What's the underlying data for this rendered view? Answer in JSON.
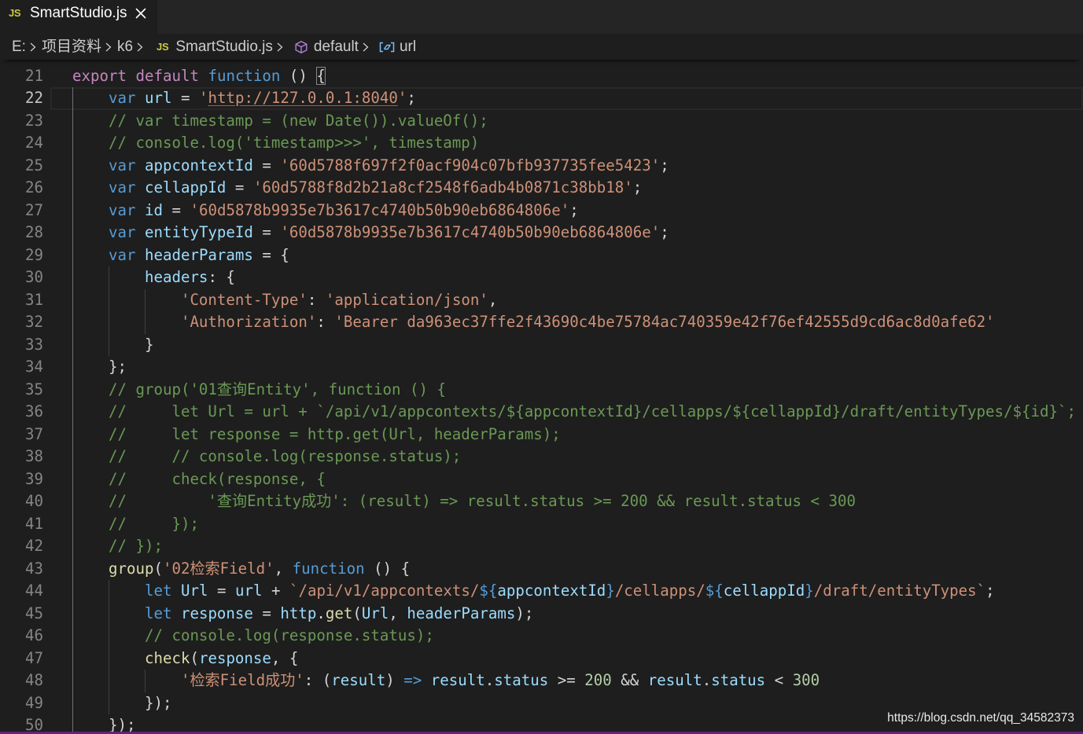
{
  "tabs": [
    {
      "icon": "js-file-icon",
      "icon_text": "JS",
      "label": "SmartStudio.js",
      "close_icon": "close-icon"
    }
  ],
  "breadcrumb": [
    {
      "label": "E:"
    },
    {
      "label": "项目资料"
    },
    {
      "label": "k6"
    },
    {
      "icon": "js-file-icon",
      "icon_text": "JS",
      "label": "SmartStudio.js"
    },
    {
      "icon": "symbol-method-icon",
      "label": "default"
    },
    {
      "icon": "symbol-variable-icon",
      "label": "url"
    }
  ],
  "separator_icon": "chevron-right-icon",
  "editor": {
    "lines": [
      {
        "n": "21",
        "t": [
          [
            "kw",
            "export"
          ],
          [
            "p",
            " "
          ],
          [
            "kw",
            "default"
          ],
          [
            "p",
            " "
          ],
          [
            "st",
            "function"
          ],
          [
            "p",
            " () "
          ],
          [
            "bm",
            "{"
          ]
        ]
      },
      {
        "n": "22",
        "current": true,
        "t": [
          [
            "st",
            "    var"
          ],
          [
            "p",
            " "
          ],
          [
            "v",
            "url"
          ],
          [
            "p",
            " = "
          ],
          [
            "s",
            "'"
          ],
          [
            "lk",
            "http://127.0.0.1:8040"
          ],
          [
            "s",
            "'"
          ],
          [
            "p",
            ";"
          ]
        ]
      },
      {
        "n": "23",
        "t": [
          [
            "c",
            "    // var timestamp = (new Date()).valueOf();"
          ]
        ]
      },
      {
        "n": "24",
        "t": [
          [
            "c",
            "    // console.log('timestamp>>>', timestamp)"
          ]
        ]
      },
      {
        "n": "25",
        "t": [
          [
            "st",
            "    var"
          ],
          [
            "p",
            " "
          ],
          [
            "v",
            "appcontextId"
          ],
          [
            "p",
            " = "
          ],
          [
            "s",
            "'60d5788f697f2f0acf904c07bfb937735fee5423'"
          ],
          [
            "p",
            ";"
          ]
        ]
      },
      {
        "n": "26",
        "t": [
          [
            "st",
            "    var"
          ],
          [
            "p",
            " "
          ],
          [
            "v",
            "cellappId"
          ],
          [
            "p",
            " = "
          ],
          [
            "s",
            "'60d5788f8d2b21a8cf2548f6adb4b0871c38bb18'"
          ],
          [
            "p",
            ";"
          ]
        ]
      },
      {
        "n": "27",
        "t": [
          [
            "st",
            "    var"
          ],
          [
            "p",
            " "
          ],
          [
            "v",
            "id"
          ],
          [
            "p",
            " = "
          ],
          [
            "s",
            "'60d5878b9935e7b3617c4740b50b90eb6864806e'"
          ],
          [
            "p",
            ";"
          ]
        ]
      },
      {
        "n": "28",
        "t": [
          [
            "st",
            "    var"
          ],
          [
            "p",
            " "
          ],
          [
            "v",
            "entityTypeId"
          ],
          [
            "p",
            " = "
          ],
          [
            "s",
            "'60d5878b9935e7b3617c4740b50b90eb6864806e'"
          ],
          [
            "p",
            ";"
          ]
        ]
      },
      {
        "n": "29",
        "t": [
          [
            "st",
            "    var"
          ],
          [
            "p",
            " "
          ],
          [
            "v",
            "headerParams"
          ],
          [
            "p",
            " = {"
          ]
        ]
      },
      {
        "n": "30",
        "t": [
          [
            "v",
            "        headers"
          ],
          [
            "p",
            ": {"
          ]
        ]
      },
      {
        "n": "31",
        "t": [
          [
            "s",
            "            'Content-Type'"
          ],
          [
            "p",
            ": "
          ],
          [
            "s",
            "'application/json'"
          ],
          [
            "p",
            ","
          ]
        ]
      },
      {
        "n": "32",
        "t": [
          [
            "s",
            "            'Authorization'"
          ],
          [
            "p",
            ": "
          ],
          [
            "s",
            "'Bearer da963ec37ffe2f43690c4be75784ac740359e42f76ef42555d9cd6ac8d0afe62'"
          ]
        ]
      },
      {
        "n": "33",
        "t": [
          [
            "p",
            "        }"
          ]
        ]
      },
      {
        "n": "34",
        "t": [
          [
            "p",
            "    };"
          ]
        ]
      },
      {
        "n": "35",
        "t": [
          [
            "c",
            "    // group('01查询Entity', function () {"
          ]
        ]
      },
      {
        "n": "36",
        "t": [
          [
            "c",
            "    //     let Url = url + `/api/v1/appcontexts/${appcontextId}/cellapps/${cellappId}/draft/entityTypes/${id}`;"
          ]
        ]
      },
      {
        "n": "37",
        "t": [
          [
            "c",
            "    //     let response = http.get(Url, headerParams);"
          ]
        ]
      },
      {
        "n": "38",
        "t": [
          [
            "c",
            "    //     // console.log(response.status);"
          ]
        ]
      },
      {
        "n": "39",
        "t": [
          [
            "c",
            "    //     check(response, {"
          ]
        ]
      },
      {
        "n": "40",
        "t": [
          [
            "c",
            "    //         '查询Entity成功': (result) => result.status >= 200 && result.status < 300"
          ]
        ]
      },
      {
        "n": "41",
        "t": [
          [
            "c",
            "    //     });"
          ]
        ]
      },
      {
        "n": "42",
        "t": [
          [
            "c",
            "    // });"
          ]
        ]
      },
      {
        "n": "43",
        "t": [
          [
            "f",
            "    group"
          ],
          [
            "p",
            "("
          ],
          [
            "s",
            "'02检索Field'"
          ],
          [
            "p",
            ", "
          ],
          [
            "st",
            "function"
          ],
          [
            "p",
            " () {"
          ]
        ]
      },
      {
        "n": "44",
        "t": [
          [
            "st",
            "        let"
          ],
          [
            "p",
            " "
          ],
          [
            "v",
            "Url"
          ],
          [
            "p",
            " = "
          ],
          [
            "v",
            "url"
          ],
          [
            "p",
            " + "
          ],
          [
            "s",
            "`/api/v1/appcontexts/"
          ],
          [
            "tp",
            "${"
          ],
          [
            "v",
            "appcontextId"
          ],
          [
            "tp",
            "}"
          ],
          [
            "s",
            "/cellapps/"
          ],
          [
            "tp",
            "${"
          ],
          [
            "v",
            "cellappId"
          ],
          [
            "tp",
            "}"
          ],
          [
            "s",
            "/draft/entityTypes`"
          ],
          [
            "p",
            ";"
          ]
        ]
      },
      {
        "n": "45",
        "t": [
          [
            "st",
            "        let"
          ],
          [
            "p",
            " "
          ],
          [
            "v",
            "response"
          ],
          [
            "p",
            " = "
          ],
          [
            "v",
            "http"
          ],
          [
            "p",
            "."
          ],
          [
            "f",
            "get"
          ],
          [
            "p",
            "("
          ],
          [
            "v",
            "Url"
          ],
          [
            "p",
            ", "
          ],
          [
            "v",
            "headerParams"
          ],
          [
            "p",
            ");"
          ]
        ]
      },
      {
        "n": "46",
        "t": [
          [
            "c",
            "        // console.log(response.status);"
          ]
        ]
      },
      {
        "n": "47",
        "t": [
          [
            "f",
            "        check"
          ],
          [
            "p",
            "("
          ],
          [
            "v",
            "response"
          ],
          [
            "p",
            ", {"
          ]
        ]
      },
      {
        "n": "48",
        "t": [
          [
            "s",
            "            '检索Field成功'"
          ],
          [
            "p",
            ": ("
          ],
          [
            "v",
            "result"
          ],
          [
            "p",
            ") "
          ],
          [
            "st",
            "=>"
          ],
          [
            "p",
            " "
          ],
          [
            "v",
            "result"
          ],
          [
            "p",
            "."
          ],
          [
            "v",
            "status"
          ],
          [
            "p",
            " >= "
          ],
          [
            "n",
            "200"
          ],
          [
            "p",
            " && "
          ],
          [
            "v",
            "result"
          ],
          [
            "p",
            "."
          ],
          [
            "v",
            "status"
          ],
          [
            "p",
            " < "
          ],
          [
            "n",
            "300"
          ]
        ]
      },
      {
        "n": "49",
        "t": [
          [
            "p",
            "        });"
          ]
        ]
      },
      {
        "n": "50",
        "t": [
          [
            "p",
            "    });"
          ]
        ]
      }
    ]
  },
  "watermark": "https://blog.csdn.net/qq_34582373",
  "theme": {
    "bg": "#1e1e1e",
    "tabbar": "#252526",
    "tab_active": "#1e1e1e",
    "tab_text": "#ffffff",
    "breadcrumb_text": "#cccccc",
    "line_number": "#858585",
    "line_number_active": "#c6c6c6",
    "current_line_border": "#282828",
    "indent_guide": "#404040",
    "indent_guide_active": "#707070",
    "keyword": "#c586c0",
    "storage": "#569cd6",
    "variable": "#9cdcfe",
    "string": "#ce9178",
    "comment": "#6a9955",
    "number": "#b5cea8",
    "function": "#dcdcaa",
    "punctuation": "#d4d4d4",
    "link_underline": "#b5574a",
    "bracket_match_border": "#888888",
    "js_icon": "#cbcb41",
    "method_icon": "#b180d7",
    "variable_icon": "#75beff",
    "status_bar": "#68217a"
  }
}
